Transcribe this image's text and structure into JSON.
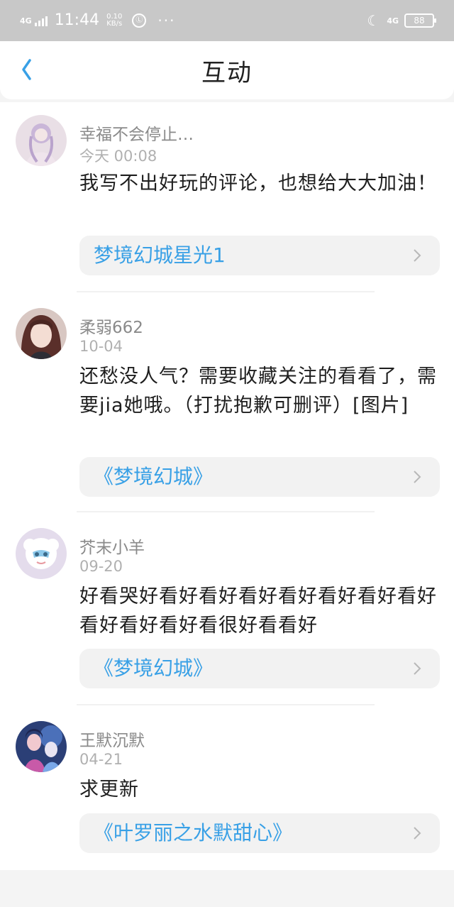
{
  "status_bar": {
    "network": "4G",
    "time": "11:44",
    "speed_value": "0.10",
    "speed_unit": "KB/s",
    "notification_glyph": "Ⓛ",
    "more": "···",
    "network_right": "4G",
    "battery": "88"
  },
  "header": {
    "title": "互动",
    "back_icon": "chevron-left-icon"
  },
  "accent_color": "#38a0e6",
  "comments": [
    {
      "user": "幸福不会停止…",
      "time": "今天 00:08",
      "text": "我写不出好玩的评论，也想给大大加油！",
      "link": "梦境幻城星光1"
    },
    {
      "user": "柔弱662",
      "time": "10-04",
      "text": "还愁没人气？需要收藏关注的看看了，需要jia她哦。（打扰抱歉可删评）[图片]",
      "link": "《梦境幻城》"
    },
    {
      "user": "芥末小羊",
      "time": "09-20",
      "text": "好看哭好看好看好看好看好看好看好看好看好看好看好看很好看看好",
      "link": "《梦境幻城》"
    },
    {
      "user": "王默沉默",
      "time": "04-21",
      "text": "求更新",
      "link": "《叶罗丽之水默甜心》"
    }
  ]
}
